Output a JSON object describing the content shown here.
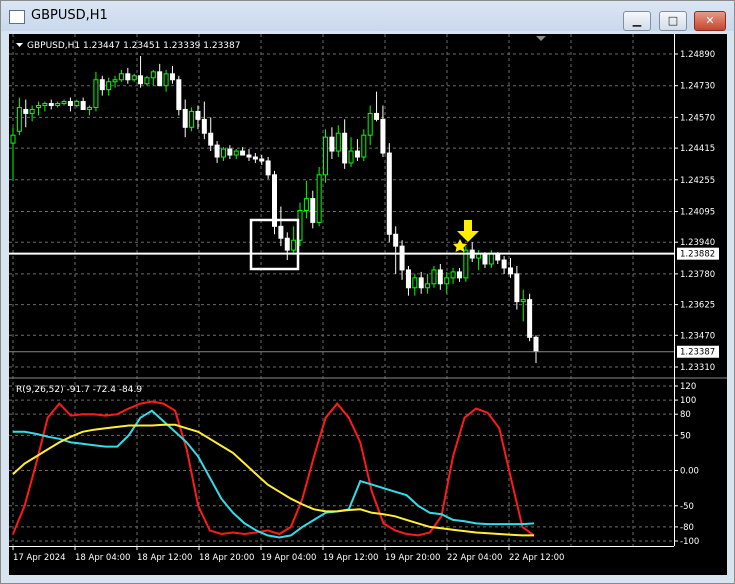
{
  "window": {
    "title": "GBPUSD,H1",
    "minimize_glyph": "▁",
    "maximize_glyph": "□",
    "close_glyph": "✕"
  },
  "price_panel": {
    "header": "GBPUSD,H1  1.23447 1.23451 1.23339 1.23387",
    "price_ticks": [
      "1.24890",
      "1.24730",
      "1.24570",
      "1.24415",
      "1.24255",
      "1.24095",
      "1.23940",
      "1.23780",
      "1.23625",
      "1.23470",
      "1.23310"
    ],
    "price_tick_values": [
      1.2489,
      1.2473,
      1.2457,
      1.24415,
      1.24255,
      1.24095,
      1.2394,
      1.2378,
      1.23625,
      1.2347,
      1.2331
    ],
    "horizontal_line_label": "1.23882",
    "horizontal_line_price": 1.23882,
    "current_price_label": "1.23387",
    "current_price": 1.23387,
    "bull_color": "#00ff00",
    "bear_color": "#ffffff",
    "highlight_box_color": "#ffffff",
    "arrow_color": "#ffee00",
    "star_color": "#ffee00"
  },
  "indicator_panel": {
    "header": "R(9,26,52) -91.7 -72.4 -84.9",
    "ticks": [
      "120",
      "100",
      "80",
      "50",
      "0.00",
      "-50",
      "-80",
      "-100"
    ],
    "tick_values": [
      120,
      100,
      80,
      50,
      0,
      -50,
      -80,
      -100
    ],
    "series_colors": [
      "#ff1a1a",
      "#33dde8",
      "#ffee33"
    ]
  },
  "x_axis": {
    "labels": [
      "17 Apr 2024",
      "18 Apr 04:00",
      "18 Apr 12:00",
      "18 Apr 20:00",
      "19 Apr 04:00",
      "19 Apr 12:00",
      "19 Apr 20:00",
      "22 Apr 04:00",
      "22 Apr 12:00"
    ]
  },
  "chart_data": [
    {
      "type": "candlestick",
      "title": "GBPUSD,H1",
      "ylim": [
        1.2331,
        1.2492
      ],
      "candles": [
        {
          "o": 1.2444,
          "h": 1.2452,
          "l": 1.2425,
          "c": 1.2448
        },
        {
          "o": 1.245,
          "h": 1.2467,
          "l": 1.2448,
          "c": 1.2462
        },
        {
          "o": 1.2461,
          "h": 1.2466,
          "l": 1.2452,
          "c": 1.2459
        },
        {
          "o": 1.2459,
          "h": 1.2463,
          "l": 1.2455,
          "c": 1.2461
        },
        {
          "o": 1.2462,
          "h": 1.2465,
          "l": 1.2458,
          "c": 1.2463
        },
        {
          "o": 1.2463,
          "h": 1.2465,
          "l": 1.246,
          "c": 1.2464
        },
        {
          "o": 1.2464,
          "h": 1.2466,
          "l": 1.2461,
          "c": 1.2463
        },
        {
          "o": 1.2463,
          "h": 1.2465,
          "l": 1.2462,
          "c": 1.2464
        },
        {
          "o": 1.2464,
          "h": 1.2466,
          "l": 1.2463,
          "c": 1.2465
        },
        {
          "o": 1.2465,
          "h": 1.2467,
          "l": 1.246,
          "c": 1.2463
        },
        {
          "o": 1.2463,
          "h": 1.2466,
          "l": 1.2462,
          "c": 1.2465
        },
        {
          "o": 1.2465,
          "h": 1.2467,
          "l": 1.2463,
          "c": 1.2461
        },
        {
          "o": 1.2461,
          "h": 1.2463,
          "l": 1.2458,
          "c": 1.2462
        },
        {
          "o": 1.2462,
          "h": 1.248,
          "l": 1.246,
          "c": 1.2476
        },
        {
          "o": 1.2476,
          "h": 1.2478,
          "l": 1.2468,
          "c": 1.2471
        },
        {
          "o": 1.2471,
          "h": 1.2477,
          "l": 1.2468,
          "c": 1.2475
        },
        {
          "o": 1.2475,
          "h": 1.2478,
          "l": 1.2472,
          "c": 1.2476
        },
        {
          "o": 1.2476,
          "h": 1.2481,
          "l": 1.2475,
          "c": 1.2479
        },
        {
          "o": 1.2479,
          "h": 1.2482,
          "l": 1.2474,
          "c": 1.2476
        },
        {
          "o": 1.2476,
          "h": 1.2479,
          "l": 1.2475,
          "c": 1.2478
        },
        {
          "o": 1.2478,
          "h": 1.2488,
          "l": 1.2472,
          "c": 1.2474
        },
        {
          "o": 1.2474,
          "h": 1.2478,
          "l": 1.2473,
          "c": 1.2477
        },
        {
          "o": 1.2477,
          "h": 1.2481,
          "l": 1.2473,
          "c": 1.248
        },
        {
          "o": 1.248,
          "h": 1.2484,
          "l": 1.2473,
          "c": 1.2473
        },
        {
          "o": 1.2473,
          "h": 1.2481,
          "l": 1.247,
          "c": 1.2479
        },
        {
          "o": 1.2479,
          "h": 1.2483,
          "l": 1.2474,
          "c": 1.2476
        },
        {
          "o": 1.2476,
          "h": 1.2478,
          "l": 1.2458,
          "c": 1.2461
        },
        {
          "o": 1.2461,
          "h": 1.2466,
          "l": 1.2447,
          "c": 1.2452
        },
        {
          "o": 1.2452,
          "h": 1.2462,
          "l": 1.245,
          "c": 1.246
        },
        {
          "o": 1.246,
          "h": 1.2463,
          "l": 1.2451,
          "c": 1.2456
        },
        {
          "o": 1.2456,
          "h": 1.2465,
          "l": 1.2446,
          "c": 1.2449
        },
        {
          "o": 1.2449,
          "h": 1.2457,
          "l": 1.244,
          "c": 1.2443
        },
        {
          "o": 1.2443,
          "h": 1.2445,
          "l": 1.2434,
          "c": 1.2437
        },
        {
          "o": 1.2437,
          "h": 1.2442,
          "l": 1.2435,
          "c": 1.2441
        },
        {
          "o": 1.2441,
          "h": 1.2443,
          "l": 1.2436,
          "c": 1.2438
        },
        {
          "o": 1.2438,
          "h": 1.2441,
          "l": 1.2436,
          "c": 1.244
        },
        {
          "o": 1.244,
          "h": 1.2442,
          "l": 1.2438,
          "c": 1.2438
        },
        {
          "o": 1.2438,
          "h": 1.2441,
          "l": 1.2435,
          "c": 1.2437
        },
        {
          "o": 1.2437,
          "h": 1.2439,
          "l": 1.2434,
          "c": 1.2436
        },
        {
          "o": 1.2436,
          "h": 1.2438,
          "l": 1.2433,
          "c": 1.2435
        },
        {
          "o": 1.2435,
          "h": 1.2437,
          "l": 1.2426,
          "c": 1.2428
        },
        {
          "o": 1.2428,
          "h": 1.243,
          "l": 1.2398,
          "c": 1.2402
        },
        {
          "o": 1.2402,
          "h": 1.2412,
          "l": 1.2392,
          "c": 1.2396
        },
        {
          "o": 1.2396,
          "h": 1.2399,
          "l": 1.2385,
          "c": 1.239
        },
        {
          "o": 1.239,
          "h": 1.2402,
          "l": 1.2388,
          "c": 1.2395
        },
        {
          "o": 1.2395,
          "h": 1.2414,
          "l": 1.2392,
          "c": 1.241
        },
        {
          "o": 1.241,
          "h": 1.2425,
          "l": 1.2406,
          "c": 1.2416
        },
        {
          "o": 1.2416,
          "h": 1.242,
          "l": 1.2401,
          "c": 1.2404
        },
        {
          "o": 1.2404,
          "h": 1.2432,
          "l": 1.2402,
          "c": 1.2428
        },
        {
          "o": 1.2428,
          "h": 1.2451,
          "l": 1.2424,
          "c": 1.2447
        },
        {
          "o": 1.2447,
          "h": 1.2452,
          "l": 1.2436,
          "c": 1.244
        },
        {
          "o": 1.244,
          "h": 1.2453,
          "l": 1.2437,
          "c": 1.2449
        },
        {
          "o": 1.2449,
          "h": 1.2456,
          "l": 1.2431,
          "c": 1.2434
        },
        {
          "o": 1.2434,
          "h": 1.2447,
          "l": 1.2432,
          "c": 1.244
        },
        {
          "o": 1.244,
          "h": 1.2446,
          "l": 1.2435,
          "c": 1.2437
        },
        {
          "o": 1.2437,
          "h": 1.2451,
          "l": 1.2435,
          "c": 1.2448
        },
        {
          "o": 1.2448,
          "h": 1.2463,
          "l": 1.2443,
          "c": 1.2459
        },
        {
          "o": 1.2459,
          "h": 1.247,
          "l": 1.2455,
          "c": 1.2456
        },
        {
          "o": 1.2456,
          "h": 1.2463,
          "l": 1.2437,
          "c": 1.2439
        },
        {
          "o": 1.2439,
          "h": 1.2444,
          "l": 1.2394,
          "c": 1.2398
        },
        {
          "o": 1.2398,
          "h": 1.2402,
          "l": 1.2378,
          "c": 1.2392
        },
        {
          "o": 1.2392,
          "h": 1.2395,
          "l": 1.2375,
          "c": 1.238
        },
        {
          "o": 1.238,
          "h": 1.2382,
          "l": 1.2367,
          "c": 1.2371
        },
        {
          "o": 1.2371,
          "h": 1.2378,
          "l": 1.2367,
          "c": 1.2376
        },
        {
          "o": 1.2376,
          "h": 1.2379,
          "l": 1.2368,
          "c": 1.2371
        },
        {
          "o": 1.2371,
          "h": 1.2378,
          "l": 1.2368,
          "c": 1.2373
        },
        {
          "o": 1.2373,
          "h": 1.2382,
          "l": 1.2371,
          "c": 1.238
        },
        {
          "o": 1.238,
          "h": 1.2383,
          "l": 1.237,
          "c": 1.2373
        },
        {
          "o": 1.2373,
          "h": 1.2379,
          "l": 1.2368,
          "c": 1.2376
        },
        {
          "o": 1.2376,
          "h": 1.2381,
          "l": 1.2373,
          "c": 1.2379
        },
        {
          "o": 1.2379,
          "h": 1.2381,
          "l": 1.2374,
          "c": 1.2376
        },
        {
          "o": 1.2376,
          "h": 1.2392,
          "l": 1.2374,
          "c": 1.239
        },
        {
          "o": 1.239,
          "h": 1.2394,
          "l": 1.2384,
          "c": 1.2386
        },
        {
          "o": 1.2386,
          "h": 1.239,
          "l": 1.238,
          "c": 1.2388
        },
        {
          "o": 1.2388,
          "h": 1.2389,
          "l": 1.2381,
          "c": 1.2383
        },
        {
          "o": 1.2383,
          "h": 1.239,
          "l": 1.2381,
          "c": 1.2388
        },
        {
          "o": 1.2388,
          "h": 1.2389,
          "l": 1.2383,
          "c": 1.2385
        },
        {
          "o": 1.2385,
          "h": 1.2387,
          "l": 1.2378,
          "c": 1.2381
        },
        {
          "o": 1.2381,
          "h": 1.2386,
          "l": 1.2376,
          "c": 1.2378
        },
        {
          "o": 1.2378,
          "h": 1.2382,
          "l": 1.236,
          "c": 1.2364
        },
        {
          "o": 1.2364,
          "h": 1.237,
          "l": 1.2354,
          "c": 1.2365
        },
        {
          "o": 1.2365,
          "h": 1.2368,
          "l": 1.2344,
          "c": 1.2346
        },
        {
          "o": 1.2346,
          "h": 1.2347,
          "l": 1.2333,
          "c": 1.2339
        }
      ]
    },
    {
      "type": "line",
      "title": "R(9,26,52)",
      "ylim": [
        -105,
        125
      ],
      "series": [
        {
          "color": "#ff1a1a",
          "values": [
            -90,
            -50,
            10,
            75,
            95,
            78,
            80,
            80,
            78,
            80,
            88,
            95,
            98,
            95,
            85,
            30,
            -50,
            -85,
            -90,
            -88,
            -90,
            -88,
            -85,
            -90,
            -80,
            -40,
            20,
            75,
            95,
            75,
            40,
            -30,
            -75,
            -85,
            -90,
            -92,
            -88,
            -65,
            20,
            75,
            88,
            82,
            60,
            -10,
            -80,
            -92
          ]
        },
        {
          "color": "#33dde8",
          "values": [
            55,
            55,
            52,
            48,
            45,
            40,
            38,
            36,
            34,
            34,
            50,
            75,
            85,
            70,
            55,
            40,
            20,
            -10,
            -40,
            -60,
            -75,
            -85,
            -92,
            -95,
            -92,
            -80,
            -70,
            -60,
            -58,
            -55,
            -15,
            -20,
            -25,
            -30,
            -35,
            -50,
            -60,
            -62,
            -70,
            -72,
            -75,
            -76,
            -76,
            -76,
            -76,
            -75
          ]
        },
        {
          "color": "#ffee33",
          "values": [
            -5,
            10,
            20,
            30,
            40,
            48,
            55,
            58,
            60,
            62,
            64,
            64,
            64,
            65,
            65,
            60,
            55,
            45,
            35,
            25,
            10,
            -5,
            -20,
            -30,
            -40,
            -48,
            -55,
            -58,
            -58,
            -56,
            -55,
            -60,
            -62,
            -65,
            -70,
            -75,
            -80,
            -82,
            -84,
            -86,
            -88,
            -89,
            -90,
            -91,
            -92,
            -92
          ]
        }
      ]
    }
  ]
}
